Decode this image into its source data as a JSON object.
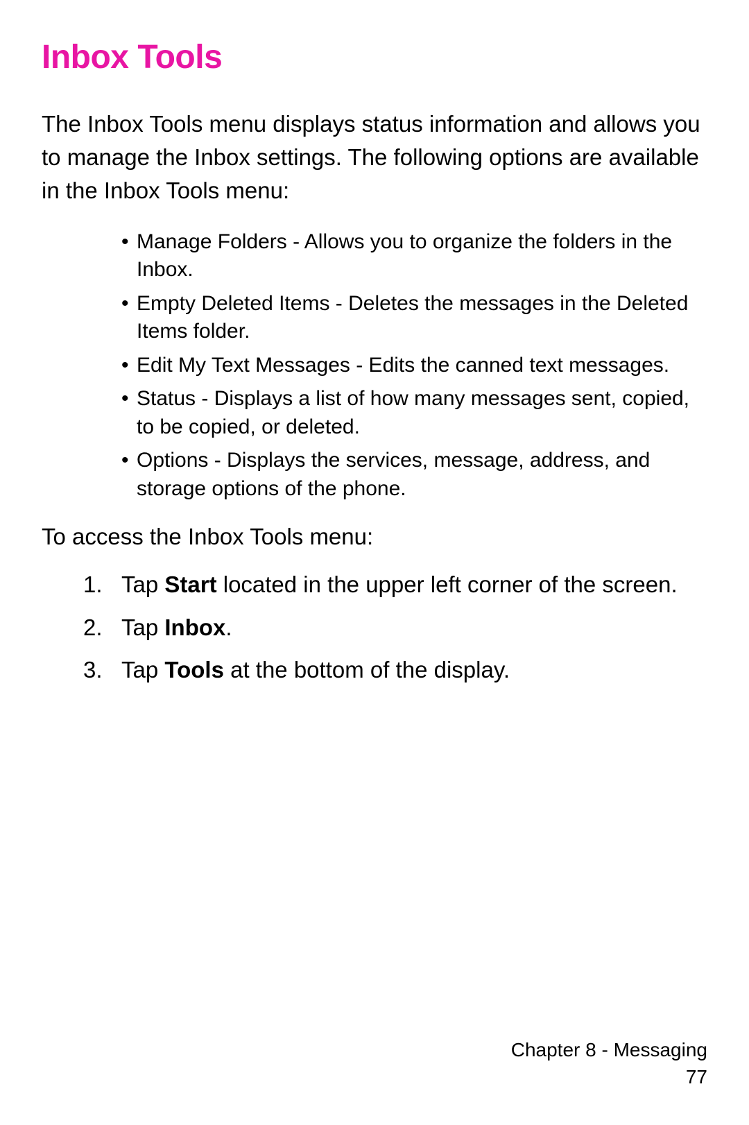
{
  "heading": "Inbox Tools",
  "intro": "The Inbox Tools menu displays status information and allows you to manage the Inbox settings. The following options are available in the Inbox Tools menu:",
  "bullets": [
    "Manage Folders - Allows you to organize the folders in the Inbox.",
    "Empty Deleted Items - Deletes the messages in the Deleted Items folder.",
    "Edit My Text Messages - Edits the canned text messages.",
    "Status - Displays a list of how many messages sent, copied, to be copied, or deleted.",
    "Options - Displays the services, message, address, and storage options of the phone."
  ],
  "accessLine": "To access the Inbox Tools menu:",
  "steps": [
    {
      "num": "1.",
      "pre": "Tap ",
      "bold": "Start",
      "post": " located in the upper left corner of the screen."
    },
    {
      "num": "2.",
      "pre": "Tap ",
      "bold": "Inbox",
      "post": "."
    },
    {
      "num": "3.",
      "pre": "Tap ",
      "bold": "Tools",
      "post": " at the bottom of the display."
    }
  ],
  "footer": {
    "chapter": "Chapter 8 - Messaging",
    "page": "77"
  }
}
